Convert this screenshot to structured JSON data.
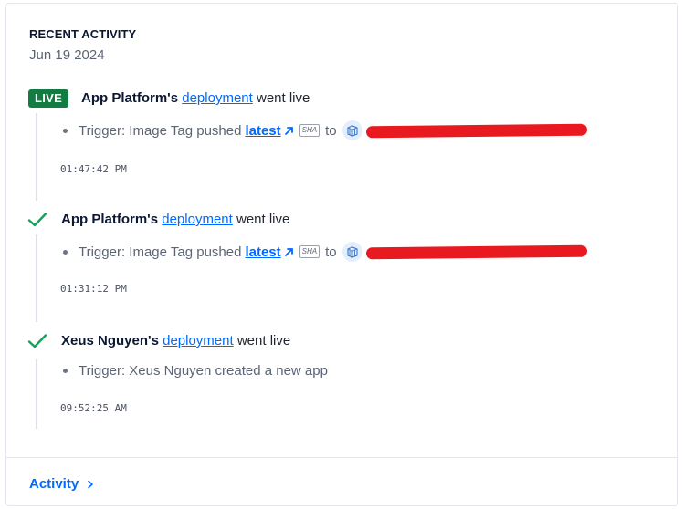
{
  "section": {
    "title": "RECENT ACTIVITY",
    "date": "Jun 19 2024"
  },
  "events": [
    {
      "status": "live",
      "badge": "LIVE",
      "actor": "App Platform's",
      "link_text": "deployment",
      "suffix": "went live",
      "trigger_prefix": "Trigger: Image Tag pushed",
      "trigger_link": "latest",
      "sha_label": "SHA",
      "to_word": "to",
      "timestamp": "01:47:42 PM"
    },
    {
      "status": "success",
      "actor": "App Platform's",
      "link_text": "deployment",
      "suffix": "went live",
      "trigger_prefix": "Trigger: Image Tag pushed",
      "trigger_link": "latest",
      "sha_label": "SHA",
      "to_word": "to",
      "timestamp": "01:31:12 PM"
    },
    {
      "status": "success",
      "actor": "Xeus Nguyen's",
      "link_text": "deployment",
      "suffix": "went live",
      "trigger_text": "Trigger: Xeus Nguyen created a new app",
      "timestamp": "09:52:25 AM"
    }
  ],
  "footer": {
    "link_label": "Activity"
  },
  "colors": {
    "accent": "#0069ff",
    "live_badge": "#137c43",
    "success_check": "#15a35b",
    "redaction": "#e8191f"
  },
  "icons": {
    "check": "check-icon",
    "external_arrow": "external-arrow-icon",
    "registry": "container-registry-icon",
    "chevron": "chevron-right-icon"
  }
}
